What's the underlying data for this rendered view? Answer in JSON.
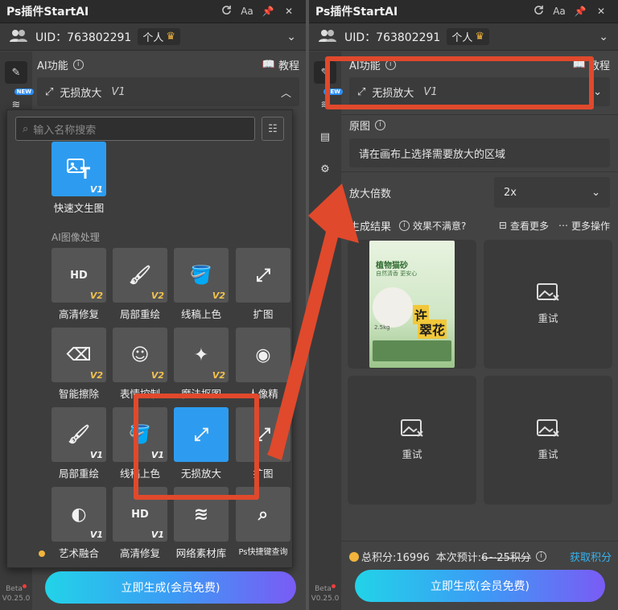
{
  "left": {
    "title": "Ps插件StartAI",
    "icons": [
      "refresh-icon",
      "font-icon",
      "pin-icon",
      "close-icon"
    ],
    "font_label": "Aa",
    "uid": "UID：763802291",
    "badge": "个人",
    "ai_label": "AI功能",
    "tutorial": "教程",
    "selected_feature": "无损放大",
    "ver_v1": "V1",
    "search_placeholder": "输入名称搜索",
    "quick_tile": {
      "label": "快速文生图",
      "ver": "V1"
    },
    "section_label": "AI图像处理",
    "tiles": [
      {
        "label": "高清修复",
        "ver": "V2"
      },
      {
        "label": "局部重绘",
        "ver": "V2"
      },
      {
        "label": "线稿上色",
        "ver": "V2"
      },
      {
        "label": "扩图",
        "ver": ""
      },
      {
        "label": "智能擦除",
        "ver": "V2"
      },
      {
        "label": "表情控制",
        "ver": "V2"
      },
      {
        "label": "魔法抠图",
        "ver": "V2"
      },
      {
        "label": "人像精",
        "ver": ""
      },
      {
        "label": "局部重绘",
        "ver": "V1"
      },
      {
        "label": "线稿上色",
        "ver": "V1"
      },
      {
        "label": "无损放大",
        "ver": ""
      },
      {
        "label": "扩图",
        "ver": ""
      },
      {
        "label": "艺术融合",
        "ver": "V1"
      },
      {
        "label": "高清修复",
        "ver": "V1"
      },
      {
        "label": "网络素材库",
        "ver": ""
      },
      {
        "label": "Ps快捷键查询",
        "ver": ""
      }
    ],
    "generate": "立即生成(会员免费)",
    "beta": "Beta",
    "version": "V0.25.0"
  },
  "right": {
    "title": "Ps插件StartAI",
    "font_label": "Aa",
    "uid": "UID：763802291",
    "badge": "个人",
    "ai_label": "AI功能",
    "tutorial": "教程",
    "selected_feature": "无损放大",
    "ver_v1": "V1",
    "original_label": "原图",
    "original_hint": "请在画布上选择需要放大的区域",
    "scale_label": "放大倍数",
    "scale_value": "2x",
    "result_label": "生成结果",
    "unsatisfied": "效果不满意?",
    "view_more": "查看更多",
    "more_ops": "更多操作",
    "poster_title": "植物猫砂",
    "poster_sub": "自然清香 更安心",
    "poster_big1": "许",
    "poster_big2": "翠花",
    "poster_num": "2.5kg",
    "retry": "重试",
    "total_points": "总积分:16996",
    "estimate": "本次预计:",
    "estimate_cost": "6~25积分",
    "get_points": "获取积分",
    "generate": "立即生成(会员免费)",
    "beta": "Beta",
    "version": "V0.25.0"
  },
  "colors": {
    "accent": "#2d9cf0",
    "highlight": "#e0492c",
    "gold": "#f2c14e",
    "link": "#36b3f0"
  }
}
